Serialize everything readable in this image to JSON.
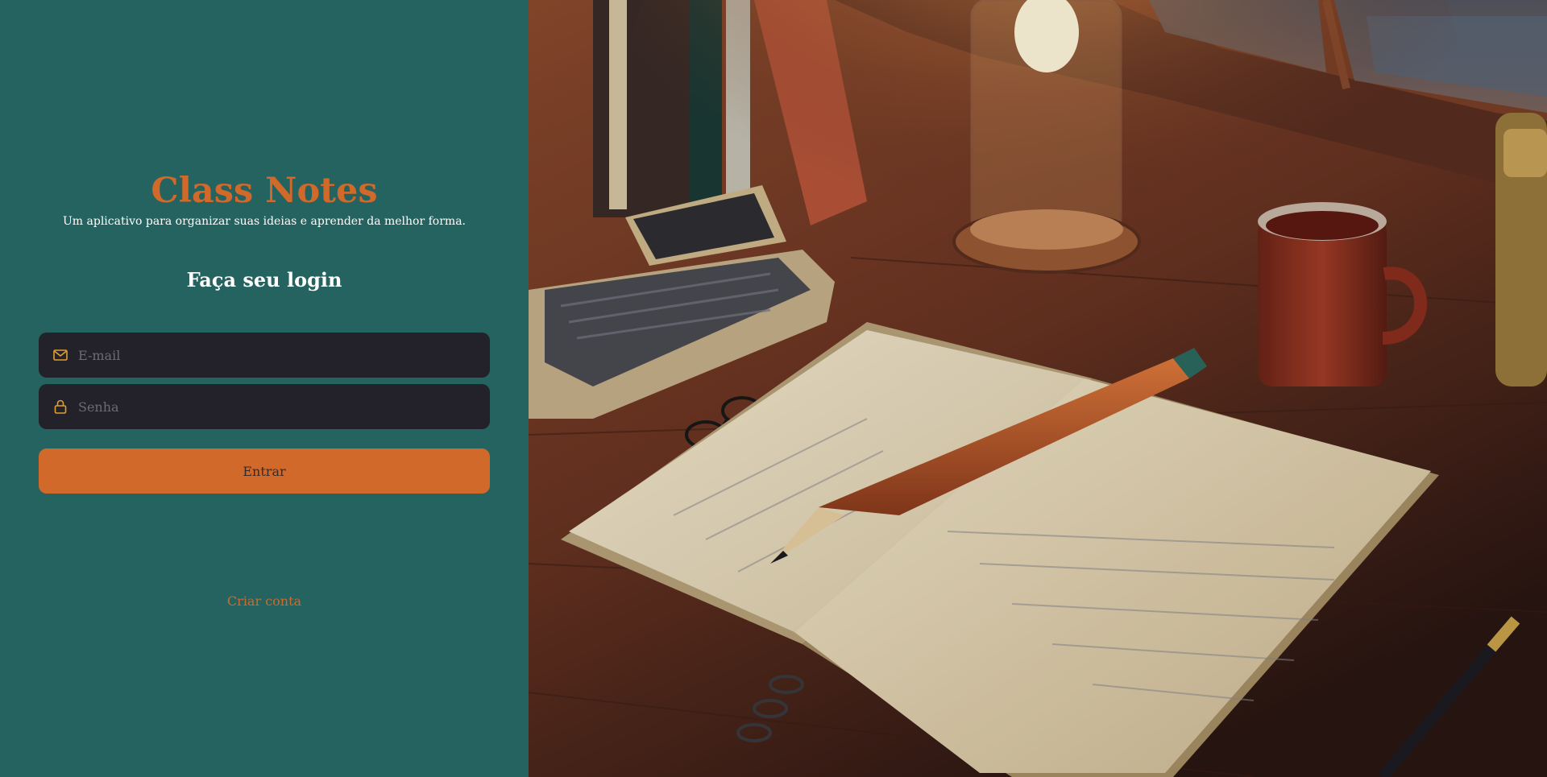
{
  "brand": {
    "title": "Class Notes",
    "tagline": "Um aplicativo para organizar suas ideias e aprender da melhor forma."
  },
  "login": {
    "heading": "Faça seu login",
    "email": {
      "placeholder": "E-mail",
      "value": "",
      "icon": "mail-icon"
    },
    "password": {
      "placeholder": "Senha",
      "value": "",
      "icon": "lock-icon"
    },
    "submit_label": "Entrar",
    "create_account_label": "Criar conta"
  },
  "colors": {
    "panel_bg": "#246360",
    "accent": "#d0692a",
    "input_bg": "#232129",
    "placeholder": "#6c6a72",
    "icon": "#e0a030"
  },
  "illustration": {
    "subject": "cozy desk with open notebook, pencil, lamp, laptop, glasses and coffee mug"
  }
}
